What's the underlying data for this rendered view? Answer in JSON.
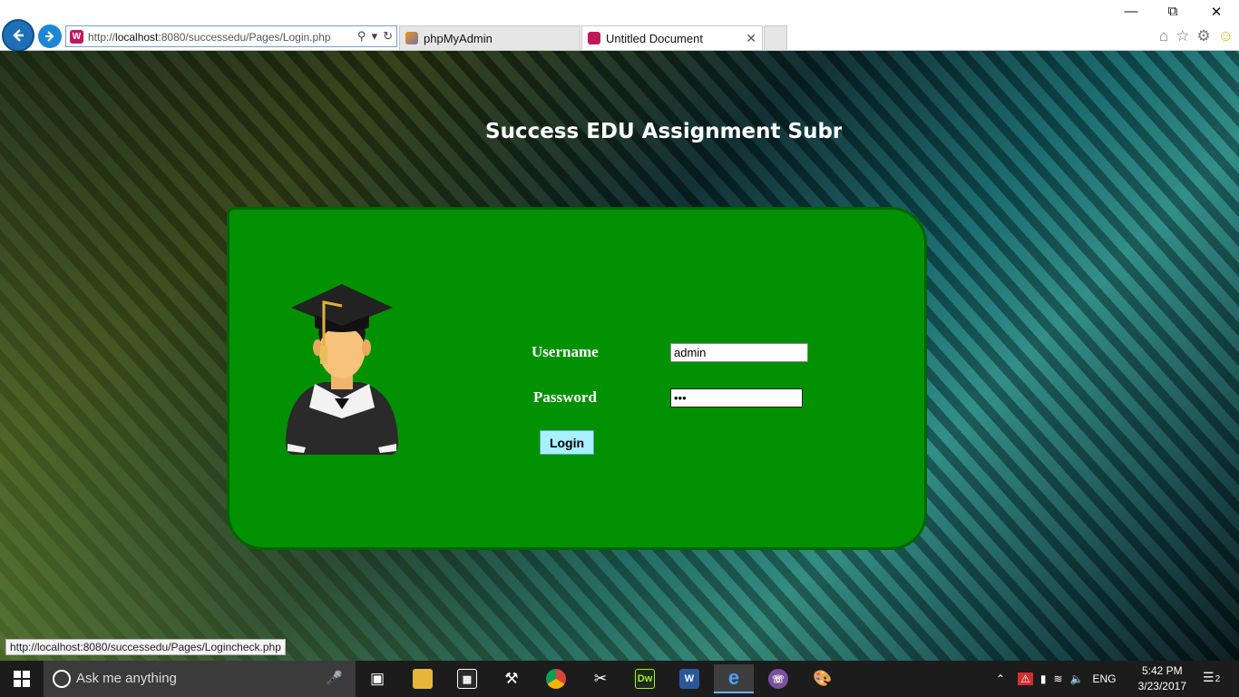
{
  "browser": {
    "address_prefix": "http://",
    "address_host": "localhost",
    "address_rest": ":8080/successedu/Pages/Login.php",
    "tabs": [
      {
        "label": "phpMyAdmin"
      },
      {
        "label": "Untitled Document"
      }
    ]
  },
  "page": {
    "title": "Success EDU Assignment Submission",
    "username_label": "Username",
    "password_label": "Password",
    "username_value": "admin",
    "password_value": "•••",
    "login_label": "Login"
  },
  "status_bar": {
    "link": "http://localhost:8080/successedu/Pages/Logincheck.php"
  },
  "taskbar": {
    "search_placeholder": "Ask me anything",
    "language": "ENG",
    "time": "5:42 PM",
    "date": "3/23/2017",
    "notification_count": "2"
  },
  "colors": {
    "panel": "#029102",
    "login_button": "#a8f0ff",
    "accent": "#1d6fb8"
  }
}
